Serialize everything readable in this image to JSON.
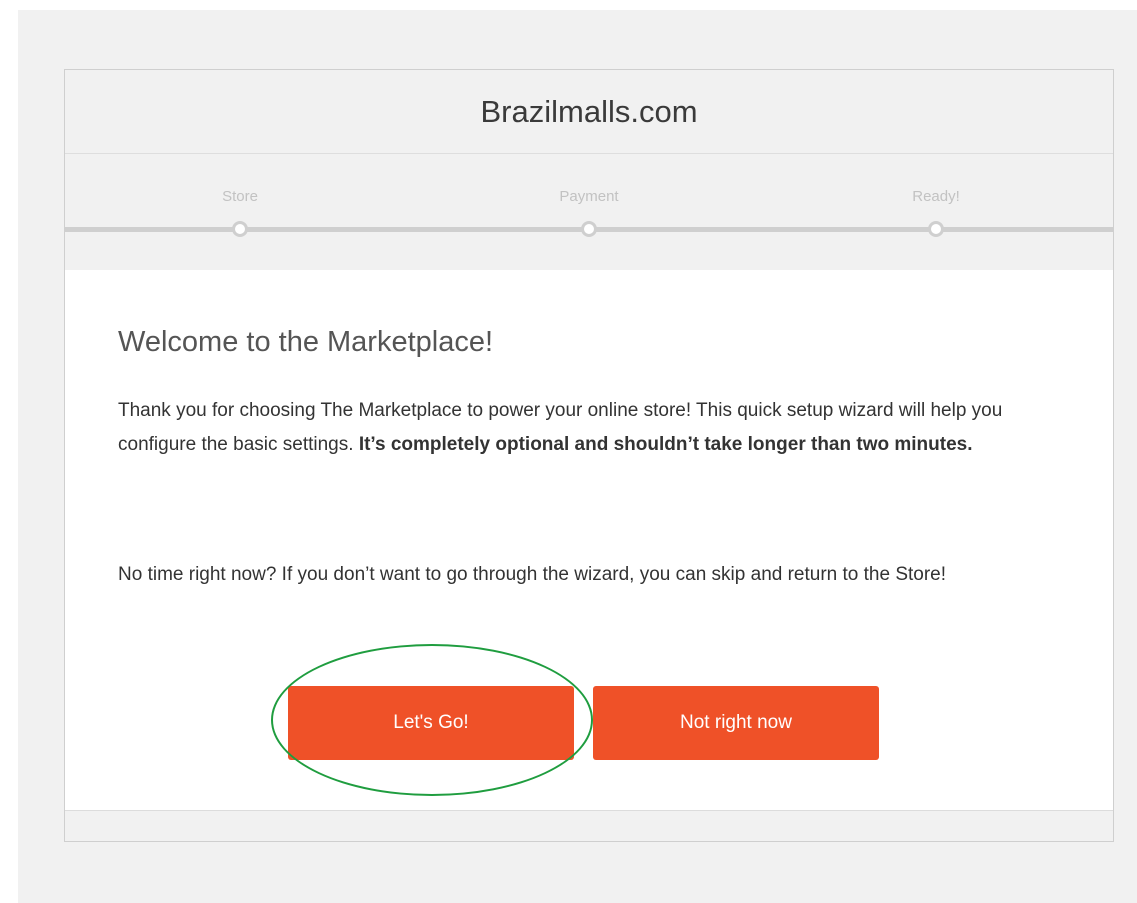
{
  "site": {
    "title": "Brazilmalls.com"
  },
  "steps": [
    {
      "label": "Store"
    },
    {
      "label": "Payment"
    },
    {
      "label": "Ready!"
    }
  ],
  "content": {
    "heading": "Welcome to the Marketplace!",
    "intro_part1": "Thank you for choosing The Marketplace to power your online store! This quick setup wizard will help you configure the basic settings.",
    "intro_bold": "It’s completely optional and shouldn’t take longer than two minutes.",
    "skip_text": "No time right now? If you don’t want to go through the wizard, you can skip and return to the Store!"
  },
  "buttons": {
    "go_label": "Let's Go!",
    "skip_label": "Not right now"
  },
  "colors": {
    "accent": "#ef5128",
    "highlight": "#1f9d3f",
    "background": "#f1f1f1"
  }
}
